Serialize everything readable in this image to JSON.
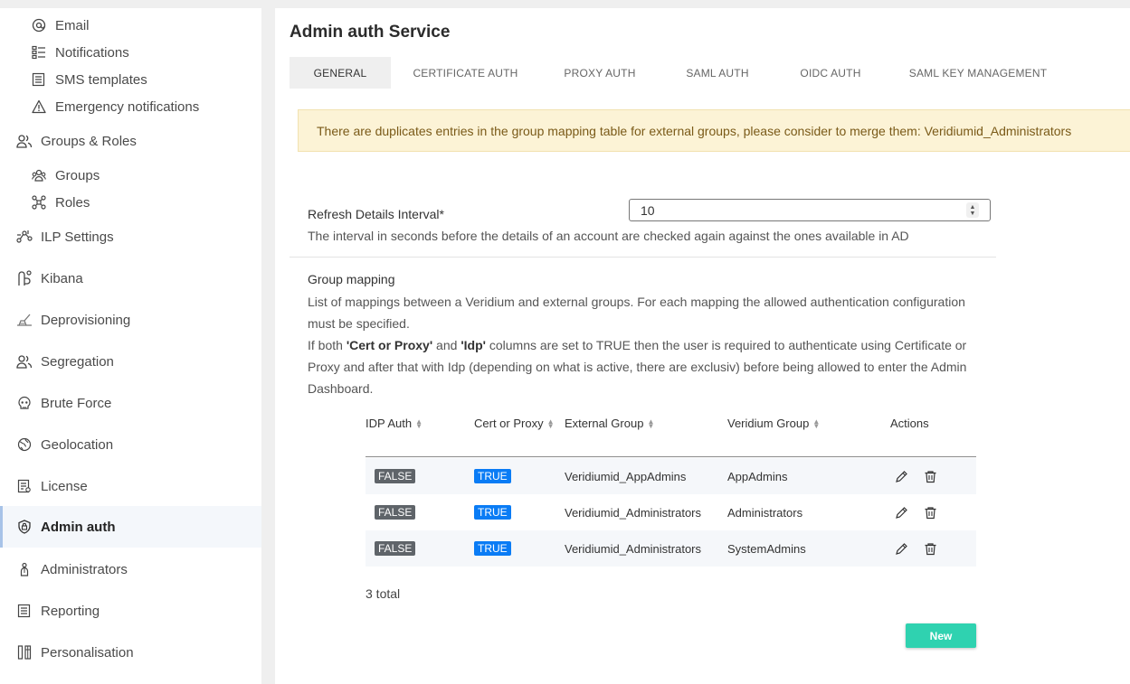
{
  "sidebar": {
    "items": [
      {
        "label": "Email",
        "icon": "at-icon"
      },
      {
        "label": "Notifications",
        "icon": "list-icon"
      },
      {
        "label": "SMS templates",
        "icon": "document-list-icon"
      },
      {
        "label": "Emergency notifications",
        "icon": "warning-icon"
      },
      {
        "label": "Groups & Roles",
        "icon": "users-icon"
      },
      {
        "label": "Groups",
        "icon": "group-icon"
      },
      {
        "label": "Roles",
        "icon": "roles-icon"
      },
      {
        "label": "ILP Settings",
        "icon": "ilp-icon"
      },
      {
        "label": "Kibana",
        "icon": "kibana-icon"
      },
      {
        "label": "Deprovisioning",
        "icon": "deprovision-icon"
      },
      {
        "label": "Segregation",
        "icon": "segregation-icon"
      },
      {
        "label": "Brute Force",
        "icon": "skull-icon"
      },
      {
        "label": "Geolocation",
        "icon": "globe-icon"
      },
      {
        "label": "License",
        "icon": "license-icon"
      },
      {
        "label": "Admin auth",
        "icon": "shield-icon"
      },
      {
        "label": "Administrators",
        "icon": "administrator-icon"
      },
      {
        "label": "Reporting",
        "icon": "report-icon"
      },
      {
        "label": "Personalisation",
        "icon": "personalisation-icon"
      }
    ],
    "active": "Admin auth"
  },
  "main": {
    "title": "Admin auth Service",
    "tabs": [
      {
        "label": "GENERAL"
      },
      {
        "label": "CERTIFICATE AUTH"
      },
      {
        "label": "PROXY AUTH"
      },
      {
        "label": "SAML AUTH"
      },
      {
        "label": "OIDC AUTH"
      },
      {
        "label": "SAML KEY MANAGEMENT"
      }
    ],
    "alert": "There are duplicates entries in the group mapping table for external groups, please consider to merge them: Veridiumid_Administrators",
    "refresh": {
      "label": "Refresh Details Interval*",
      "value": "10",
      "description": "The interval in seconds before the details of an account are checked again against the ones available in AD"
    },
    "group_mapping": {
      "title": "Group mapping",
      "description_1": "List of mappings between a Veridium and external groups. For each mapping the allowed authentication configuration must be specified.",
      "description_2_prefix": "If both ",
      "description_2_bold_1": "'Cert or Proxy'",
      "description_2_mid": " and ",
      "description_2_bold_2": "'Idp'",
      "description_2_suffix": " columns are set to TRUE then the user is required to authenticate using Certificate or Proxy and after that with Idp (depending on what is active, there are exclusiv) before being allowed to enter the Admin Dashboard.",
      "columns": {
        "idp_auth": "IDP Auth",
        "cert_or_proxy": "Cert or Proxy",
        "external_group": "External Group",
        "veridium_group": "Veridium Group",
        "actions": "Actions"
      },
      "rows": [
        {
          "idp_auth": "FALSE",
          "cert_or_proxy": "TRUE",
          "external_group": "Veridiumid_AppAdmins",
          "veridium_group": "AppAdmins"
        },
        {
          "idp_auth": "FALSE",
          "cert_or_proxy": "TRUE",
          "external_group": "Veridiumid_Administrators",
          "veridium_group": "Administrators"
        },
        {
          "idp_auth": "FALSE",
          "cert_or_proxy": "TRUE",
          "external_group": "Veridiumid_Administrators",
          "veridium_group": "SystemAdmins"
        }
      ],
      "total": "3 total",
      "new_button": "New"
    }
  },
  "colors": {
    "accent": "#2fd2b0",
    "true_badge": "#0a7cf5",
    "false_badge": "#5f6469",
    "alert_bg": "#fcf3d6"
  }
}
